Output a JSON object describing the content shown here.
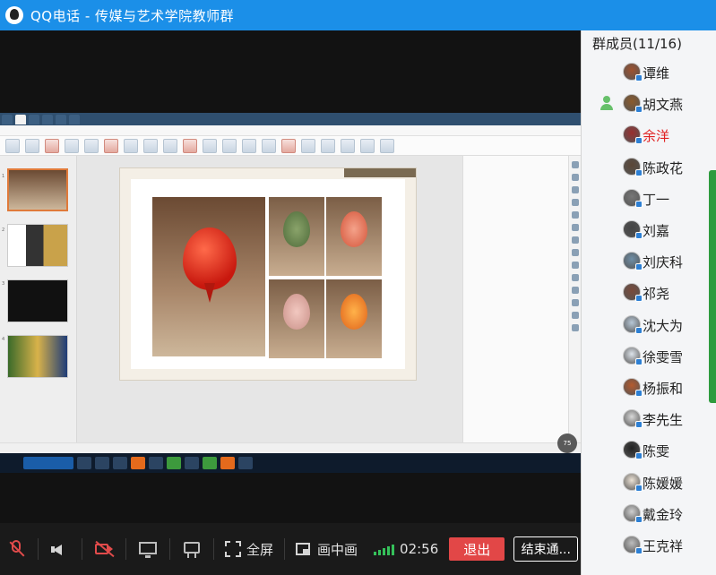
{
  "window": {
    "title": "QQ电话 - 传媒与艺术学院教师群"
  },
  "colors": {
    "titlebar": "#1b8fe8",
    "exit": "#e24747",
    "speaking": "#e02020",
    "signal": "#35c15a"
  },
  "shared_screen": {
    "zoom_badge": "75"
  },
  "controls": {
    "mic": "mic-muted-icon",
    "speaker": "speaker-icon",
    "camera": "camera-off-icon",
    "share": "screen-share-icon",
    "board": "whiteboard-icon",
    "fullscreen_label": "全屏",
    "pip_label": "画中画",
    "timer": "02:56",
    "exit_label": "退出",
    "end_label": "结束通..."
  },
  "members": {
    "title": "群成员(11/16)",
    "list": [
      {
        "name": "谭维",
        "host": false,
        "speaking": false,
        "avatar_color": "#a0522d"
      },
      {
        "name": "胡文燕",
        "host": true,
        "speaking": false,
        "avatar_color": "#8b5a2b"
      },
      {
        "name": "余洋",
        "host": false,
        "speaking": true,
        "avatar_color": "#9a2f2f"
      },
      {
        "name": "陈政花",
        "host": false,
        "speaking": false,
        "avatar_color": "#5b4636"
      },
      {
        "name": "丁一",
        "host": false,
        "speaking": false,
        "avatar_color": "#777777"
      },
      {
        "name": "刘嘉",
        "host": false,
        "speaking": false,
        "avatar_color": "#444444"
      },
      {
        "name": "刘庆科",
        "host": false,
        "speaking": false,
        "avatar_color": "#6f8fa7"
      },
      {
        "name": "祁尧",
        "host": false,
        "speaking": false,
        "avatar_color": "#7a4a3a"
      },
      {
        "name": "沈大为",
        "host": false,
        "speaking": false,
        "avatar_color": "#b7c7d6"
      },
      {
        "name": "徐雯雪",
        "host": false,
        "speaking": false,
        "avatar_color": "#dde3ea"
      },
      {
        "name": "杨振和",
        "host": false,
        "speaking": false,
        "avatar_color": "#b55a2e"
      },
      {
        "name": "李先生",
        "host": false,
        "speaking": false,
        "avatar_color": "#d8d8d8"
      },
      {
        "name": "陈雯",
        "host": false,
        "speaking": false,
        "avatar_color": "#222222"
      },
      {
        "name": "陈媛媛",
        "host": false,
        "speaking": false,
        "avatar_color": "#ece2d5"
      },
      {
        "name": "戴金玲",
        "host": false,
        "speaking": false,
        "avatar_color": "#cfcfcf"
      },
      {
        "name": "王克祥",
        "host": false,
        "speaking": false,
        "avatar_color": "#bdbdbd"
      }
    ]
  }
}
